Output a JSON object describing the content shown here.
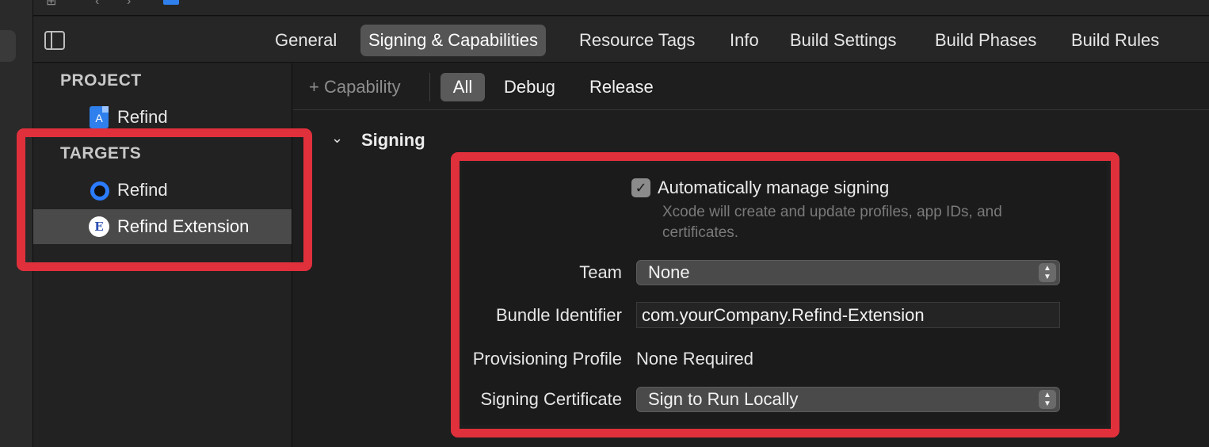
{
  "toolbar": {
    "glyphs": [
      "⊞",
      "‹",
      "›"
    ]
  },
  "tabs": [
    {
      "label": "General",
      "active": false
    },
    {
      "label": "Signing & Capabilities",
      "active": true
    },
    {
      "label": "Resource Tags",
      "active": false
    },
    {
      "label": "Info",
      "active": false
    },
    {
      "label": "Build Settings",
      "active": false
    },
    {
      "label": "Build Phases",
      "active": false
    },
    {
      "label": "Build Rules",
      "active": false
    }
  ],
  "sidebar": {
    "project_title": "PROJECT",
    "project_item": "Refind",
    "targets_title": "TARGETS",
    "targets": [
      {
        "label": "Refind",
        "icon": "target-icon",
        "selected": false
      },
      {
        "label": "Refind Extension",
        "icon": "extension-icon",
        "icon_glyph": "E",
        "selected": true
      }
    ]
  },
  "filters": {
    "add_capability": "+ Capability",
    "options": [
      "All",
      "Debug",
      "Release"
    ],
    "selected": "All"
  },
  "signing": {
    "section_title": "Signing",
    "auto_manage_label": "Automatically manage signing",
    "auto_manage_checked": true,
    "auto_manage_help": "Xcode will create and update profiles, app IDs, and certificates.",
    "team_label": "Team",
    "team_value": "None",
    "bundle_id_label": "Bundle Identifier",
    "bundle_id_value": "com.yourCompany.Refind-Extension",
    "provisioning_label": "Provisioning Profile",
    "provisioning_value": "None Required",
    "certificate_label": "Signing Certificate",
    "certificate_value": "Sign to Run Locally"
  },
  "colors": {
    "annotation_red": "#e0303c",
    "accent_blue": "#2b7cff",
    "selected_row": "#4a4a4a"
  }
}
